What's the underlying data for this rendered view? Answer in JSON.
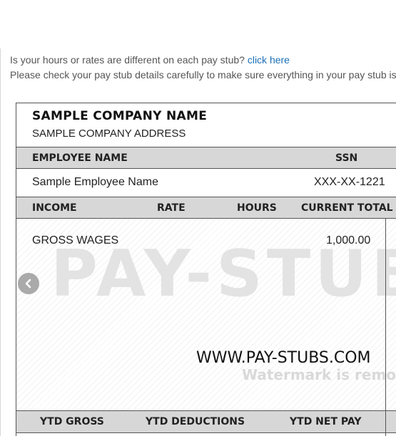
{
  "notice": {
    "question": "Is your hours or rates are different on each pay stub?",
    "link_label": "click here",
    "instructions": "Please check your pay stub details carefully to make sure everything in your pay stub is"
  },
  "stub": {
    "company_name": "SAMPLE COMPANY NAME",
    "company_address": "SAMPLE COMPANY ADDRESS",
    "employee_header": {
      "name_label": "EMPLOYEE NAME",
      "ssn_label": "SSN"
    },
    "employee": {
      "name": "Sample Employee Name",
      "ssn": "XXX-XX-1221"
    },
    "income_header": {
      "income": "INCOME",
      "rate": "RATE",
      "hours": "HOURS",
      "current_total": "CURRENT TOTAL"
    },
    "income_rows": [
      {
        "label": "GROSS WAGES",
        "amount": "1,000.00"
      }
    ],
    "ytd_header": {
      "gross": "YTD GROSS",
      "deductions": "YTD DEDUCTIONS",
      "net": "YTD NET PAY"
    },
    "watermark": {
      "big_text": "PAY-STUB",
      "url": "WWW.PAY-STUBS.COM",
      "note": "Watermark is removed"
    }
  },
  "carousel": {
    "prev_icon": "chevron-left-icon"
  },
  "colors": {
    "link": "#1a6fb5",
    "band": "#d7d7d7",
    "arrow": "#aaaaaa"
  }
}
